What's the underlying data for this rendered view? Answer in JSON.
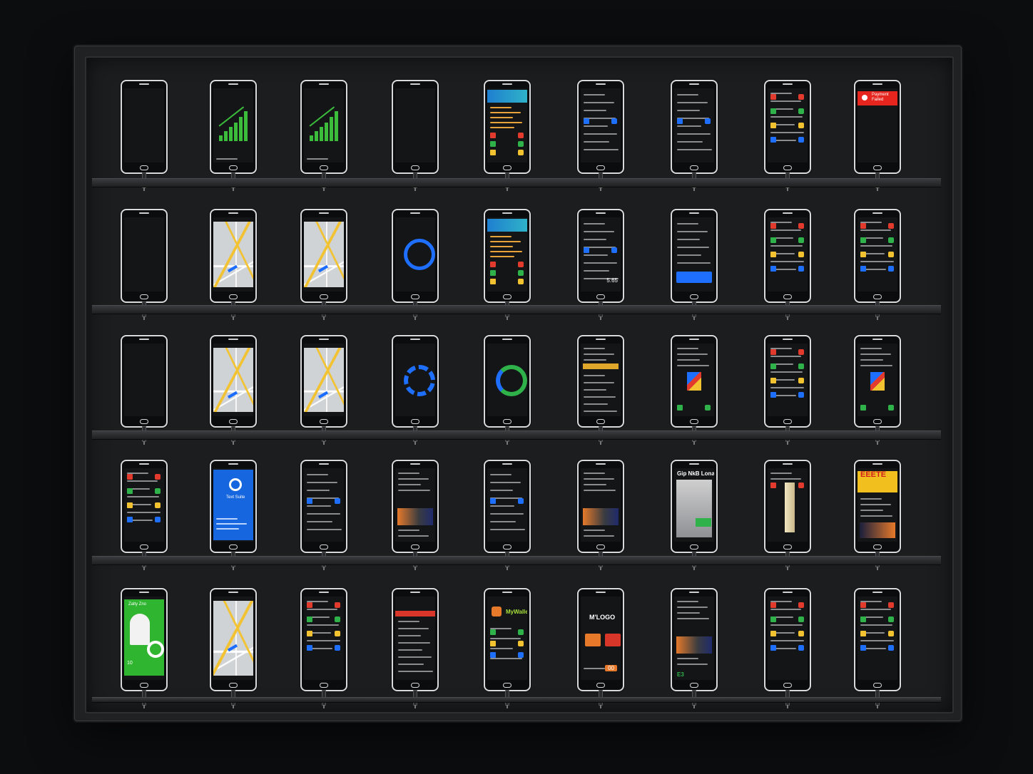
{
  "wall": {
    "rows": [
      [
        {
          "screen": "blank"
        },
        {
          "screen": "chart"
        },
        {
          "screen": "chart"
        },
        {
          "screen": "blank"
        },
        {
          "screen": "list-colorful"
        },
        {
          "screen": "list"
        },
        {
          "screen": "list"
        },
        {
          "screen": "list-icons"
        },
        {
          "screen": "alert",
          "text": [
            "Payment",
            "Failed"
          ]
        }
      ],
      [
        {
          "screen": "blank"
        },
        {
          "screen": "map"
        },
        {
          "screen": "map"
        },
        {
          "screen": "spinner-blue"
        },
        {
          "screen": "list-colorful"
        },
        {
          "screen": "list",
          "text": [
            "5.65"
          ]
        },
        {
          "screen": "list-blue-button"
        },
        {
          "screen": "list-icons"
        },
        {
          "screen": "list-icons"
        }
      ],
      [
        {
          "screen": "blank"
        },
        {
          "screen": "map"
        },
        {
          "screen": "map"
        },
        {
          "screen": "spinner-blue-segmented"
        },
        {
          "screen": "spinner-green"
        },
        {
          "screen": "list-yellow-bar"
        },
        {
          "screen": "list-tiles"
        },
        {
          "screen": "list-icons"
        },
        {
          "screen": "list-tiles"
        }
      ],
      [
        {
          "screen": "list-icons"
        },
        {
          "screen": "blue-card",
          "text": [
            "Text Suite"
          ]
        },
        {
          "screen": "list"
        },
        {
          "screen": "list-image"
        },
        {
          "screen": "list"
        },
        {
          "screen": "list-image"
        },
        {
          "screen": "poster",
          "text": [
            "Gip NkB Lona"
          ]
        },
        {
          "screen": "poster-figure"
        },
        {
          "screen": "yellow-header",
          "text": [
            "EEETE"
          ]
        }
      ],
      [
        {
          "screen": "green-card",
          "text": [
            "Zalty Zno",
            "10"
          ]
        },
        {
          "screen": "map"
        },
        {
          "screen": "list-icons"
        },
        {
          "screen": "list-red-header"
        },
        {
          "screen": "wallet",
          "text": [
            "MyWallet"
          ]
        },
        {
          "screen": "logo",
          "text": [
            "M'LOGO",
            "00"
          ]
        },
        {
          "screen": "list-image",
          "text": [
            "E3"
          ]
        },
        {
          "screen": "list-icons"
        },
        {
          "screen": "list-icons"
        }
      ]
    ]
  }
}
